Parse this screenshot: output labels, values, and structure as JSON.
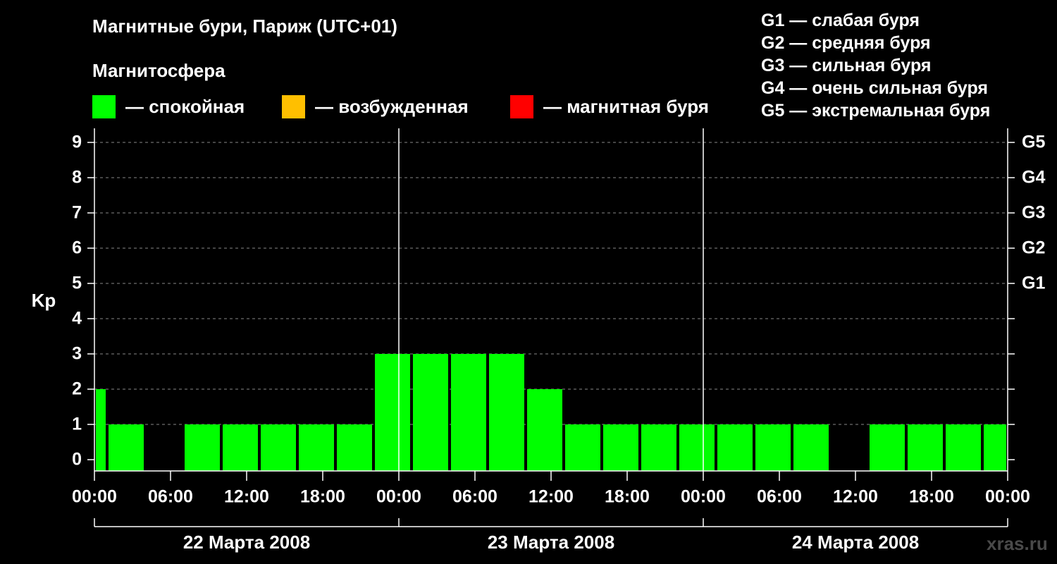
{
  "title": "Магнитные бури, Париж (UTC+01)",
  "legend": {
    "title": "Магнитосфера",
    "items": [
      {
        "label": "— спокойная",
        "color": "#00ff00"
      },
      {
        "label": "— возбужденная",
        "color": "#ffbf00"
      },
      {
        "label": "— магнитная буря",
        "color": "#ff0000"
      }
    ]
  },
  "g_scale": [
    "G1 — слабая буря",
    "G2 — средняя буря",
    "G3 — сильная буря",
    "G4 — очень сильная буря",
    "G5 — экстремальная буря"
  ],
  "watermark": "xras.ru",
  "chart_data": {
    "type": "bar",
    "ylabel": "Kp",
    "ylim": [
      0,
      9
    ],
    "yticks": [
      0,
      1,
      2,
      3,
      4,
      5,
      6,
      7,
      8,
      9
    ],
    "right_ticks": [
      {
        "kp": 5,
        "label": "G1"
      },
      {
        "kp": 6,
        "label": "G2"
      },
      {
        "kp": 7,
        "label": "G3"
      },
      {
        "kp": 8,
        "label": "G4"
      },
      {
        "kp": 9,
        "label": "G5"
      }
    ],
    "x_start": "22 Марта 2008 00:00",
    "x_tick_labels": [
      "00:00",
      "06:00",
      "12:00",
      "18:00",
      "00:00",
      "06:00",
      "12:00",
      "18:00",
      "00:00",
      "06:00",
      "12:00",
      "18:00",
      "00:00"
    ],
    "days": [
      "22 Марта 2008",
      "23 Марта 2008",
      "24 Марта 2008"
    ],
    "grid": true,
    "bar_color": "#00ff00",
    "bars": [
      {
        "start": "22 Марта 2008 00:00",
        "end": "22 Марта 2008 01:00",
        "kp": 2
      },
      {
        "start": "22 Марта 2008 01:00",
        "end": "22 Марта 2008 04:00",
        "kp": 1
      },
      {
        "start": "22 Марта 2008 04:00",
        "end": "22 Марта 2008 07:00",
        "kp": 0
      },
      {
        "start": "22 Марта 2008 07:00",
        "end": "22 Марта 2008 10:00",
        "kp": 1
      },
      {
        "start": "22 Марта 2008 10:00",
        "end": "22 Марта 2008 13:00",
        "kp": 1
      },
      {
        "start": "22 Марта 2008 13:00",
        "end": "22 Марта 2008 16:00",
        "kp": 1
      },
      {
        "start": "22 Марта 2008 16:00",
        "end": "22 Марта 2008 19:00",
        "kp": 1
      },
      {
        "start": "22 Марта 2008 19:00",
        "end": "22 Марта 2008 22:00",
        "kp": 1
      },
      {
        "start": "22 Марта 2008 22:00",
        "end": "23 Марта 2008 01:00",
        "kp": 3
      },
      {
        "start": "23 Марта 2008 01:00",
        "end": "23 Марта 2008 04:00",
        "kp": 3
      },
      {
        "start": "23 Марта 2008 04:00",
        "end": "23 Марта 2008 07:00",
        "kp": 3
      },
      {
        "start": "23 Марта 2008 07:00",
        "end": "23 Марта 2008 10:00",
        "kp": 3
      },
      {
        "start": "23 Марта 2008 10:00",
        "end": "23 Марта 2008 13:00",
        "kp": 2
      },
      {
        "start": "23 Марта 2008 13:00",
        "end": "23 Марта 2008 16:00",
        "kp": 1
      },
      {
        "start": "23 Марта 2008 16:00",
        "end": "23 Марта 2008 19:00",
        "kp": 1
      },
      {
        "start": "23 Марта 2008 19:00",
        "end": "23 Марта 2008 22:00",
        "kp": 1
      },
      {
        "start": "23 Марта 2008 22:00",
        "end": "24 Марта 2008 01:00",
        "kp": 1
      },
      {
        "start": "24 Марта 2008 01:00",
        "end": "24 Марта 2008 04:00",
        "kp": 1
      },
      {
        "start": "24 Марта 2008 04:00",
        "end": "24 Марта 2008 07:00",
        "kp": 1
      },
      {
        "start": "24 Марта 2008 07:00",
        "end": "24 Марта 2008 10:00",
        "kp": 1
      },
      {
        "start": "24 Марта 2008 10:00",
        "end": "24 Марта 2008 13:00",
        "kp": 0
      },
      {
        "start": "24 Марта 2008 13:00",
        "end": "24 Марта 2008 16:00",
        "kp": 1
      },
      {
        "start": "24 Марта 2008 16:00",
        "end": "24 Марта 2008 19:00",
        "kp": 1
      },
      {
        "start": "24 Марта 2008 19:00",
        "end": "24 Марта 2008 22:00",
        "kp": 1
      },
      {
        "start": "24 Марта 2008 22:00",
        "end": "25 Марта 2008 00:00",
        "kp": 1
      }
    ]
  }
}
